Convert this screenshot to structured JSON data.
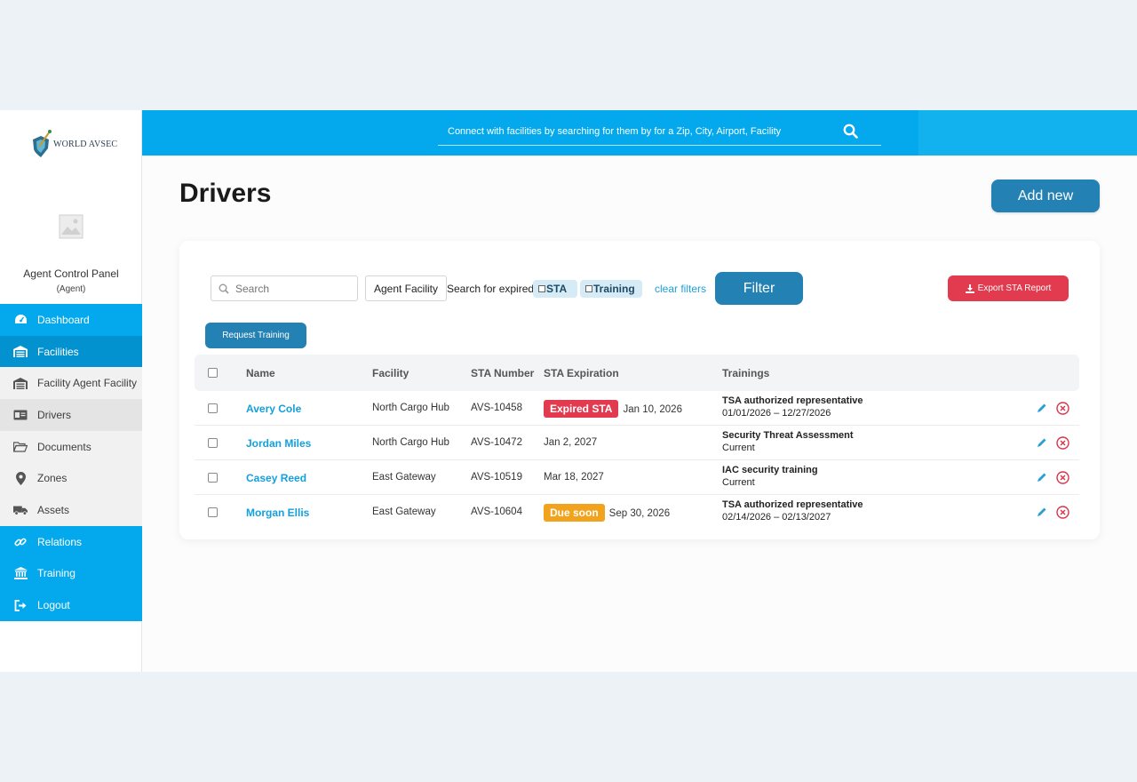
{
  "brand": {
    "name": "WORLD AVSEC"
  },
  "panel": {
    "title": "Agent Control Panel",
    "role": "(Agent)"
  },
  "nav": [
    {
      "label": "Dashboard",
      "icon": "dashboard-icon"
    },
    {
      "label": "Facilities",
      "icon": "warehouse-icon"
    },
    {
      "label": "Facility Agent Facility",
      "icon": "warehouse-icon"
    },
    {
      "label": "Drivers",
      "icon": "id-card-icon"
    },
    {
      "label": "Documents",
      "icon": "folder-icon"
    },
    {
      "label": "Zones",
      "icon": "map-marker-icon"
    },
    {
      "label": "Assets",
      "icon": "truck-icon"
    },
    {
      "label": "Relations",
      "icon": "link-icon"
    },
    {
      "label": "Training",
      "icon": "institution-icon"
    },
    {
      "label": "Logout",
      "icon": "sign-out-icon"
    }
  ],
  "topbar": {
    "search_placeholder": "Connect with facilities by searching for them by for a Zip, City, Airport, Facility"
  },
  "page": {
    "title": "Drivers",
    "add_label": "Add new"
  },
  "filters": {
    "search_placeholder": "Search",
    "facility_select": "Agent Facility",
    "expired_label": "Search for expired",
    "sta_chip": "STA",
    "training_chip": "Training",
    "clear_label": "clear filters",
    "filter_label": "Filter",
    "export_label": "Export STA Report",
    "request_training_label": "Request Training"
  },
  "table": {
    "headers": {
      "name": "Name",
      "facility": "Facility",
      "sta_number": "STA Number",
      "sta_expiration": "STA Expiration",
      "trainings": "Trainings"
    },
    "rows": [
      {
        "name": "Avery Cole",
        "facility": "North Cargo Hub",
        "sta_number": "AVS-10458",
        "badge": "Expired STA",
        "badge_color": "#e23a4f",
        "expiration": "Jan 10, 2026",
        "training_title": "TSA authorized representative",
        "training_sub": "01/01/2026 – 12/27/2026"
      },
      {
        "name": "Jordan Miles",
        "facility": "North Cargo Hub",
        "sta_number": "AVS-10472",
        "badge": "",
        "expiration": "Jan 2, 2027",
        "training_title": "Security Threat Assessment",
        "training_sub": "Current"
      },
      {
        "name": "Casey Reed",
        "facility": "East Gateway",
        "sta_number": "AVS-10519",
        "badge": "",
        "expiration": "Mar 18, 2027",
        "training_title": "IAC security training",
        "training_sub": "Current"
      },
      {
        "name": "Morgan Ellis",
        "facility": "East Gateway",
        "sta_number": "AVS-10604",
        "badge": "Due soon",
        "badge_color": "#f2a31d",
        "expiration": "Sep 30, 2026",
        "training_title": "TSA authorized representative",
        "training_sub": "02/14/2026 – 02/13/2027"
      }
    ]
  },
  "colors": {
    "primary": "#03a9ec",
    "button": "#2481b3",
    "danger": "#e23a4f",
    "warning": "#f2a31d",
    "link": "#14a0dc"
  }
}
